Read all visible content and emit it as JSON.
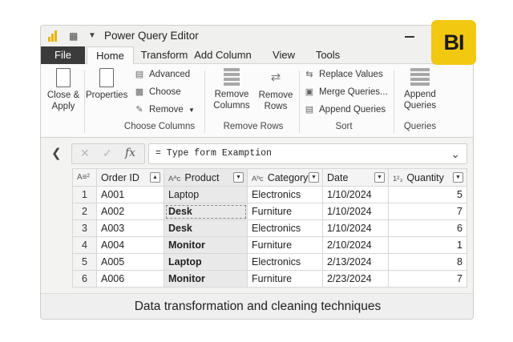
{
  "window": {
    "title": "Power Query Editor"
  },
  "logo": {
    "text": "BI",
    "color": "#f2c811"
  },
  "tabs": {
    "file": "File",
    "home": "Home",
    "transform": "Transform",
    "add_column": "Add Column",
    "view": "View",
    "tools": "Tools"
  },
  "ribbon": {
    "close_apply": "Close &\nApply",
    "properties": "Properties",
    "advanced": "Advanced",
    "choose": "Choose",
    "remove": "Remove",
    "choose_columns_group": "Choose Columns",
    "remove_columns": "Remove\nColumns",
    "remove_rows": "Remove\nRows",
    "remove_rows_group": "Remove Rows",
    "replace_values": "Replace Values",
    "merge_queries": "Merge Queries...",
    "append_queries_small": "Append Queries",
    "sort_group": "Sort",
    "append_queries": "Append\nQueries",
    "queries_group": "Queries"
  },
  "formula": {
    "text": "= Type form Examption"
  },
  "table": {
    "headers": [
      {
        "label": "Order ID",
        "type_icon": "A≡²"
      },
      {
        "label": "Product",
        "type_icon": "Aᴬᴄ"
      },
      {
        "label": "Category",
        "type_icon": "Aᵇc"
      },
      {
        "label": "Date",
        "type_icon": ""
      },
      {
        "label": "Quantity",
        "type_icon": "1²₃"
      }
    ],
    "rows": [
      {
        "n": "1",
        "order_id": "A001",
        "product": "Laptop",
        "category": "Electronics",
        "date": "1/10/2024",
        "quantity": "5"
      },
      {
        "n": "2",
        "order_id": "A002",
        "product": "Desk",
        "category": "Furniture",
        "date": "1/10/2024",
        "quantity": "7"
      },
      {
        "n": "3",
        "order_id": "A003",
        "product": "Desk",
        "category": "Electronics",
        "date": "1/10/2024",
        "quantity": "6"
      },
      {
        "n": "4",
        "order_id": "A004",
        "product": "Monitor",
        "category": "Furniture",
        "date": "2/10/2024",
        "quantity": "1"
      },
      {
        "n": "5",
        "order_id": "A005",
        "product": "Laptop",
        "category": "Electronics",
        "date": "2/13/2024",
        "quantity": "8"
      },
      {
        "n": "6",
        "order_id": "A006",
        "product": "Monitor",
        "category": "Furniture",
        "date": "2/23/2024",
        "quantity": "7"
      }
    ]
  },
  "caption": "Data transformation and cleaning techniques"
}
